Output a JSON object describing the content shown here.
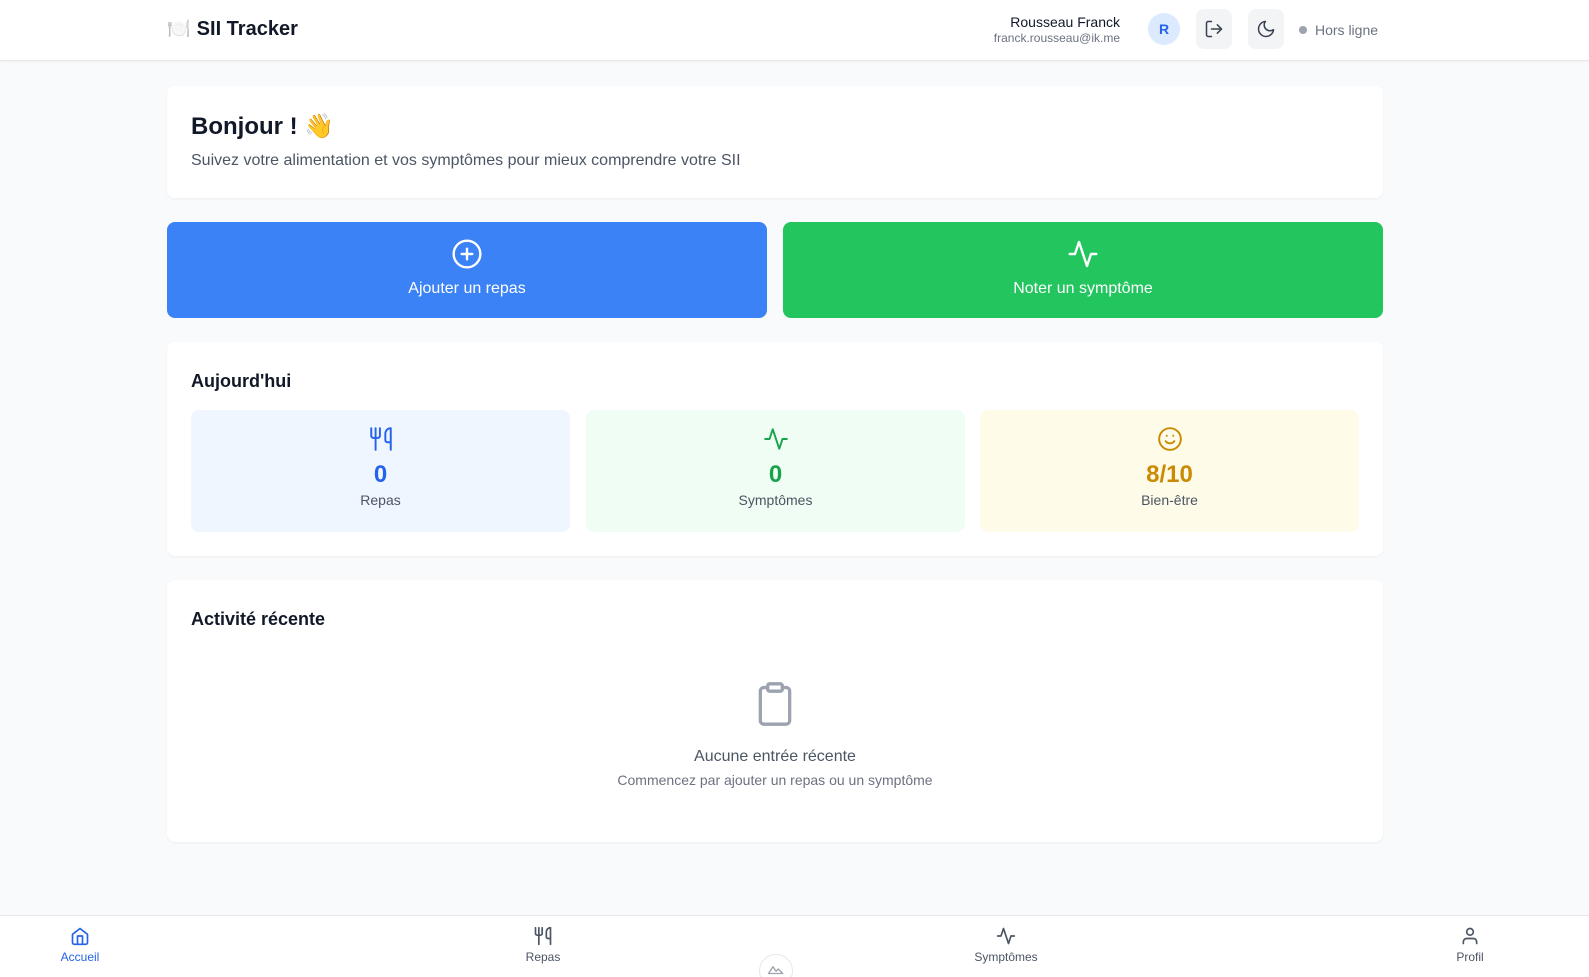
{
  "header": {
    "brand_icon": "🍽️",
    "brand_name": "SII Tracker",
    "user_name": "Rousseau Franck",
    "user_email": "franck.rousseau@ik.me",
    "avatar_initial": "R",
    "status_text": "Hors ligne",
    "icons": {
      "logout": "logout-icon",
      "theme": "moon-icon"
    }
  },
  "greeting": {
    "title": "Bonjour ! 👋",
    "subtitle": "Suivez votre alimentation et vos symptômes pour mieux comprendre votre SII"
  },
  "actions": {
    "add_meal": "Ajouter un repas",
    "add_symptom": "Noter un symptôme"
  },
  "today": {
    "title": "Aujourd'hui",
    "meals": {
      "value": "0",
      "label": "Repas"
    },
    "symptoms": {
      "value": "0",
      "label": "Symptômes"
    },
    "wellbeing": {
      "value": "8/10",
      "label": "Bien-être"
    }
  },
  "recent": {
    "title": "Activité récente",
    "empty_title": "Aucune entrée récente",
    "empty_subtitle": "Commencez par ajouter un repas ou un symptôme"
  },
  "nav": {
    "home": "Accueil",
    "meals": "Repas",
    "symptoms": "Symptômes",
    "profile": "Profil"
  },
  "colors": {
    "primary_blue": "#3b82f6",
    "primary_green": "#22c55e",
    "wellbeing_amber": "#ca8a04",
    "active_nav": "#2563eb"
  }
}
